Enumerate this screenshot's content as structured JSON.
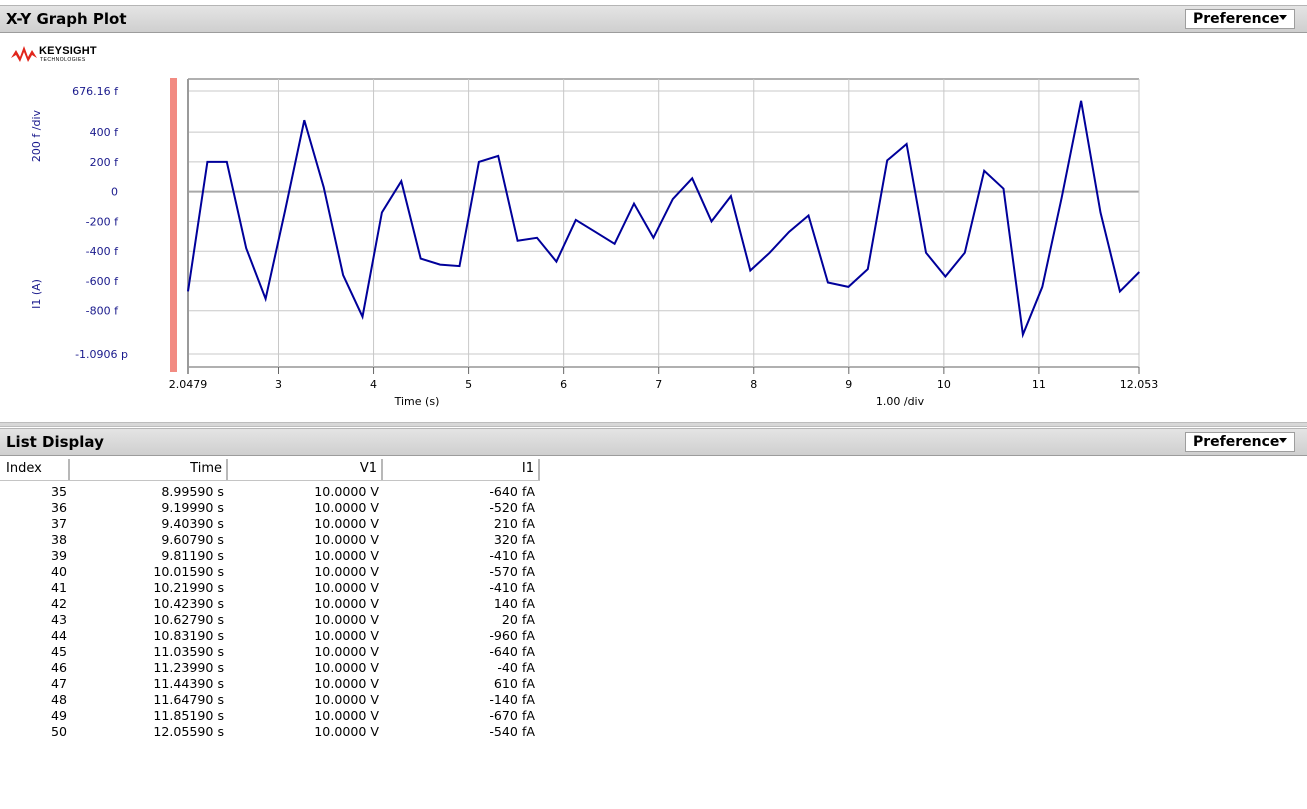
{
  "graph_panel": {
    "title": "X-Y Graph Plot",
    "preference_label": "Preference",
    "logo": {
      "name": "KEYSIGHT",
      "sub": "TECHNOLOGIES"
    }
  },
  "list_panel": {
    "title": "List Display",
    "preference_label": "Preference",
    "columns": [
      "Index",
      "Time",
      "V1",
      "I1"
    ],
    "rows": [
      [
        "35",
        "8.99590 s",
        "10.0000 V",
        "-640 fA"
      ],
      [
        "36",
        "9.19990 s",
        "10.0000 V",
        "-520 fA"
      ],
      [
        "37",
        "9.40390 s",
        "10.0000 V",
        "210 fA"
      ],
      [
        "38",
        "9.60790 s",
        "10.0000 V",
        "320 fA"
      ],
      [
        "39",
        "9.81190 s",
        "10.0000 V",
        "-410 fA"
      ],
      [
        "40",
        "10.01590 s",
        "10.0000 V",
        "-570 fA"
      ],
      [
        "41",
        "10.21990 s",
        "10.0000 V",
        "-410 fA"
      ],
      [
        "42",
        "10.42390 s",
        "10.0000 V",
        "140 fA"
      ],
      [
        "43",
        "10.62790 s",
        "10.0000 V",
        "20 fA"
      ],
      [
        "44",
        "10.83190 s",
        "10.0000 V",
        "-960 fA"
      ],
      [
        "45",
        "11.03590 s",
        "10.0000 V",
        "-640 fA"
      ],
      [
        "46",
        "11.23990 s",
        "10.0000 V",
        "-40 fA"
      ],
      [
        "47",
        "11.44390 s",
        "10.0000 V",
        "610 fA"
      ],
      [
        "48",
        "11.64790 s",
        "10.0000 V",
        "-140 fA"
      ],
      [
        "49",
        "11.85190 s",
        "10.0000 V",
        "-670 fA"
      ],
      [
        "50",
        "12.05590 s",
        "10.0000 V",
        "-540 fA"
      ]
    ]
  },
  "colors": {
    "trace": "#00009a",
    "axis_text": "#1a1a8c",
    "grid": "#c8c8c8",
    "marker": "#f28b82"
  },
  "chart_data": {
    "type": "line",
    "xlabel": "Time (s)",
    "ylabel": "I1 (A)",
    "x_div_label": "1.00  /div",
    "y_div_label": "200 f /div",
    "xlim": [
      2.0479,
      12.053
    ],
    "ylim": [
      -1.0906e-12,
      6.7616e-13
    ],
    "x_ticks": [
      {
        "v": 2.0479,
        "label": "2.0479"
      },
      {
        "v": 3,
        "label": "3"
      },
      {
        "v": 4,
        "label": "4"
      },
      {
        "v": 5,
        "label": "5"
      },
      {
        "v": 6,
        "label": "6"
      },
      {
        "v": 7,
        "label": "7"
      },
      {
        "v": 8,
        "label": "8"
      },
      {
        "v": 9,
        "label": "9"
      },
      {
        "v": 10,
        "label": "10"
      },
      {
        "v": 11,
        "label": "11"
      },
      {
        "v": 12.053,
        "label": "12.053"
      }
    ],
    "y_ticks": [
      {
        "v": 6.7616e-13,
        "label": "676.16 f"
      },
      {
        "v": 4e-13,
        "label": "400 f"
      },
      {
        "v": 2e-13,
        "label": "200 f"
      },
      {
        "v": 0,
        "label": "0"
      },
      {
        "v": -2e-13,
        "label": "-200 f"
      },
      {
        "v": -4e-13,
        "label": "-400 f"
      },
      {
        "v": -6e-13,
        "label": "-600 f"
      },
      {
        "v": -8e-13,
        "label": "-800 f"
      },
      {
        "v": -1.0906e-12,
        "label": "-1.0906 p"
      }
    ],
    "series": [
      {
        "values_fA": [
          [
            2.0479,
            -670
          ],
          [
            2.2519,
            200
          ],
          [
            2.4559,
            200
          ],
          [
            2.6599,
            -380
          ],
          [
            2.8639,
            -720
          ],
          [
            3.0679,
            -130
          ],
          [
            3.2719,
            480
          ],
          [
            3.4759,
            30
          ],
          [
            3.6799,
            -560
          ],
          [
            3.8839,
            -840
          ],
          [
            4.0879,
            -140
          ],
          [
            4.2919,
            70
          ],
          [
            4.4959,
            -450
          ],
          [
            4.6999,
            -490
          ],
          [
            4.9039,
            -500
          ],
          [
            5.1079,
            200
          ],
          [
            5.3119,
            240
          ],
          [
            5.5159,
            -330
          ],
          [
            5.7199,
            -310
          ],
          [
            5.9239,
            -470
          ],
          [
            6.1279,
            -190
          ],
          [
            6.3319,
            -270
          ],
          [
            6.5359,
            -350
          ],
          [
            6.7399,
            -80
          ],
          [
            6.9439,
            -310
          ],
          [
            7.1479,
            -50
          ],
          [
            7.3519,
            90
          ],
          [
            7.5559,
            -200
          ],
          [
            7.7599,
            -30
          ],
          [
            7.9639,
            -530
          ],
          [
            8.1679,
            -410
          ],
          [
            8.3719,
            -270
          ],
          [
            8.5759,
            -160
          ],
          [
            8.7799,
            -610
          ],
          [
            8.9959,
            -640
          ],
          [
            9.1999,
            -520
          ],
          [
            9.4039,
            210
          ],
          [
            9.6079,
            320
          ],
          [
            9.8119,
            -410
          ],
          [
            10.0159,
            -570
          ],
          [
            10.2199,
            -410
          ],
          [
            10.4239,
            140
          ],
          [
            10.6279,
            20
          ],
          [
            10.8319,
            -960
          ],
          [
            11.0359,
            -640
          ],
          [
            11.2399,
            -40
          ],
          [
            11.4439,
            610
          ],
          [
            11.6479,
            -140
          ],
          [
            11.8519,
            -670
          ],
          [
            12.0559,
            -540
          ]
        ]
      }
    ]
  }
}
